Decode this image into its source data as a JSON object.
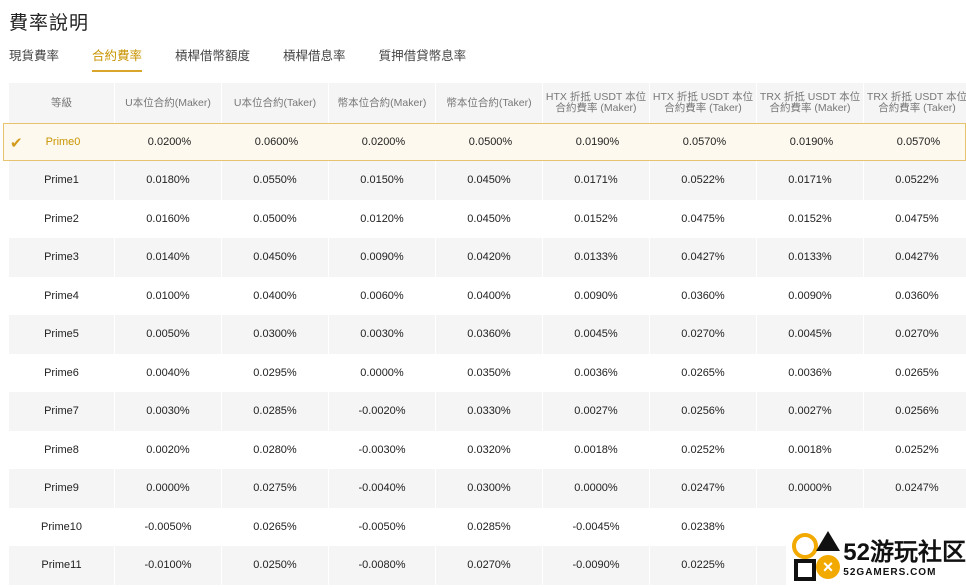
{
  "title": "費率說明",
  "tabs": [
    "現貨費率",
    "合約費率",
    "槓桿借幣額度",
    "槓桿借息率",
    "質押借貸幣息率"
  ],
  "active_tab": 1,
  "columns": [
    "等級",
    "U本位合約(Maker)",
    "U本位合約(Taker)",
    "幣本位合約(Maker)",
    "幣本位合約(Taker)",
    "HTX 折抵 USDT 本位合約費率 (Maker)",
    "HTX 折抵 USDT 本位合約費率 (Taker)",
    "TRX 折抵 USDT 本位合約費率 (Maker)",
    "TRX 折抵 USDT 本位合約費率 (Taker)"
  ],
  "rows": [
    [
      "Prime0",
      "0.0200%",
      "0.0600%",
      "0.0200%",
      "0.0500%",
      "0.0190%",
      "0.0570%",
      "0.0190%",
      "0.0570%"
    ],
    [
      "Prime1",
      "0.0180%",
      "0.0550%",
      "0.0150%",
      "0.0450%",
      "0.0171%",
      "0.0522%",
      "0.0171%",
      "0.0522%"
    ],
    [
      "Prime2",
      "0.0160%",
      "0.0500%",
      "0.0120%",
      "0.0450%",
      "0.0152%",
      "0.0475%",
      "0.0152%",
      "0.0475%"
    ],
    [
      "Prime3",
      "0.0140%",
      "0.0450%",
      "0.0090%",
      "0.0420%",
      "0.0133%",
      "0.0427%",
      "0.0133%",
      "0.0427%"
    ],
    [
      "Prime4",
      "0.0100%",
      "0.0400%",
      "0.0060%",
      "0.0400%",
      "0.0090%",
      "0.0360%",
      "0.0090%",
      "0.0360%"
    ],
    [
      "Prime5",
      "0.0050%",
      "0.0300%",
      "0.0030%",
      "0.0360%",
      "0.0045%",
      "0.0270%",
      "0.0045%",
      "0.0270%"
    ],
    [
      "Prime6",
      "0.0040%",
      "0.0295%",
      "0.0000%",
      "0.0350%",
      "0.0036%",
      "0.0265%",
      "0.0036%",
      "0.0265%"
    ],
    [
      "Prime7",
      "0.0030%",
      "0.0285%",
      "-0.0020%",
      "0.0330%",
      "0.0027%",
      "0.0256%",
      "0.0027%",
      "0.0256%"
    ],
    [
      "Prime8",
      "0.0020%",
      "0.0280%",
      "-0.0030%",
      "0.0320%",
      "0.0018%",
      "0.0252%",
      "0.0018%",
      "0.0252%"
    ],
    [
      "Prime9",
      "0.0000%",
      "0.0275%",
      "-0.0040%",
      "0.0300%",
      "0.0000%",
      "0.0247%",
      "0.0000%",
      "0.0247%"
    ],
    [
      "Prime10",
      "-0.0050%",
      "0.0265%",
      "-0.0050%",
      "0.0285%",
      "-0.0045%",
      "0.0238%",
      "",
      ""
    ],
    [
      "Prime11",
      "-0.0100%",
      "0.0250%",
      "-0.0080%",
      "0.0270%",
      "-0.0090%",
      "0.0225%",
      "",
      ""
    ]
  ],
  "selected_row": 0,
  "watermark": {
    "big": "52游玩社区",
    "small": "52GAMERS.COM"
  },
  "colors": {
    "accent": "#d9a62b",
    "row_alt": "#f5f5f5",
    "selected_bg": "#fdf9ee"
  }
}
